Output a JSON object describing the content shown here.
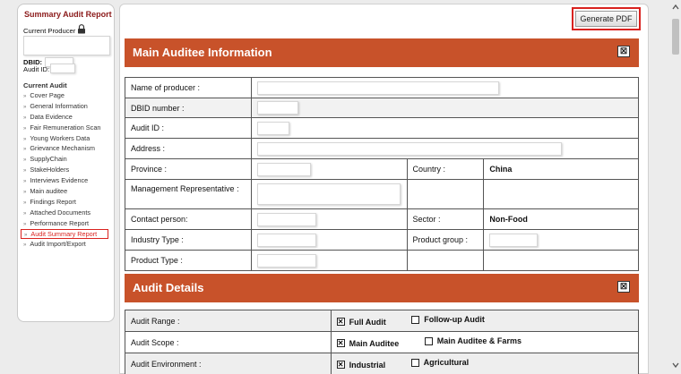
{
  "sidebar": {
    "title": "Summary Audit Report",
    "current_producer_label": "Current Producer",
    "dbid_label": "DBID:",
    "audit_id_label": "Audit ID:",
    "current_audit_label": "Current Audit",
    "items": [
      {
        "label": "Cover Page"
      },
      {
        "label": "General Information"
      },
      {
        "label": "Data Evidence"
      },
      {
        "label": "Fair Remuneration Scan"
      },
      {
        "label": "Young Workers Data"
      },
      {
        "label": "Grievance Mechanism"
      },
      {
        "label": "SupplyChain"
      },
      {
        "label": "StakeHolders"
      },
      {
        "label": "Interviews Evidence"
      },
      {
        "label": "Main auditee"
      },
      {
        "label": "Findings Report"
      },
      {
        "label": "Attached Documents"
      },
      {
        "label": "Performance Report"
      },
      {
        "label": "Audit Summary Report"
      },
      {
        "label": "Audit Import/Export"
      }
    ],
    "active_item": "Audit Summary Report"
  },
  "toolbar": {
    "generate_pdf": "Generate PDF"
  },
  "main_auditee": {
    "title": "Main Auditee Information",
    "fields": {
      "name_of_producer": "Name of producer :",
      "dbid_number": "DBID number :",
      "audit_id": "Audit ID :",
      "address": "Address :",
      "province": "Province :",
      "country_label": "Country :",
      "country_value": "China",
      "management_rep": "Management Representative :",
      "contact_person": "Contact person:",
      "sector_label": "Sector :",
      "sector_value": "Non-Food",
      "industry_type": "Industry Type :",
      "product_group": "Product group :",
      "product_type": "Product Type :"
    }
  },
  "audit_details": {
    "title": "Audit Details",
    "rows": [
      {
        "label": "Audit Range :",
        "options": [
          {
            "label": "Full Audit",
            "checked": true
          },
          {
            "label": "Follow-up Audit",
            "checked": false
          }
        ]
      },
      {
        "label": "Audit Scope :",
        "options": [
          {
            "label": "Main Auditee",
            "checked": true
          },
          {
            "label": "Main Auditee & Farms",
            "checked": false
          }
        ]
      },
      {
        "label": "Audit Environment :",
        "options": [
          {
            "label": "Industrial",
            "checked": true
          },
          {
            "label": "Agricultural",
            "checked": false
          }
        ]
      }
    ]
  },
  "colors": {
    "header_orange": "#c8522a",
    "sidebar_title": "#8b1a1a",
    "highlight_red": "#d9221f"
  }
}
